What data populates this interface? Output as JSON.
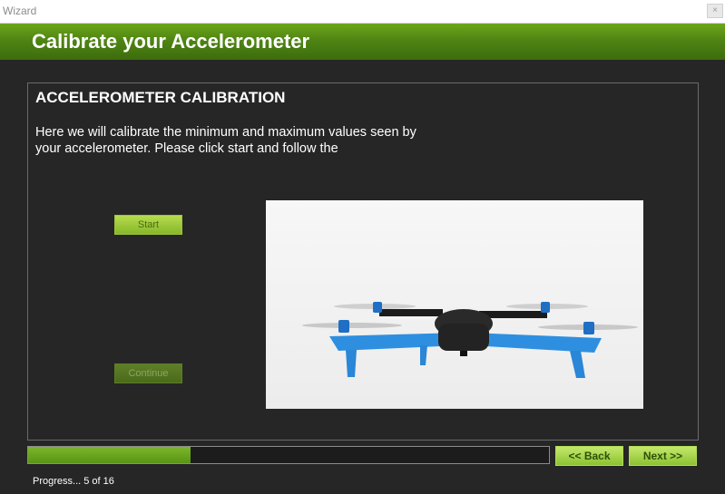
{
  "window": {
    "title": "Wizard",
    "close_label": "×"
  },
  "header": {
    "title": "Calibrate your Accelerometer"
  },
  "content": {
    "section_title": "ACCELEROMETER CALIBRATION",
    "instructions": "Here we will calibrate the minimum and maximum values seen by your accelerometer. Please click start and follow the",
    "start_label": "Start",
    "continue_label": "Continue",
    "image_subject": "quadcopter-drone-photo"
  },
  "navigation": {
    "back_label": "<< Back",
    "next_label": "Next >>"
  },
  "progress": {
    "current": 5,
    "total": 16,
    "text": "Progress... 5 of 16"
  },
  "colors": {
    "accent_green": "#4f8513",
    "button_green": "#8cc232",
    "background": "#262626"
  }
}
